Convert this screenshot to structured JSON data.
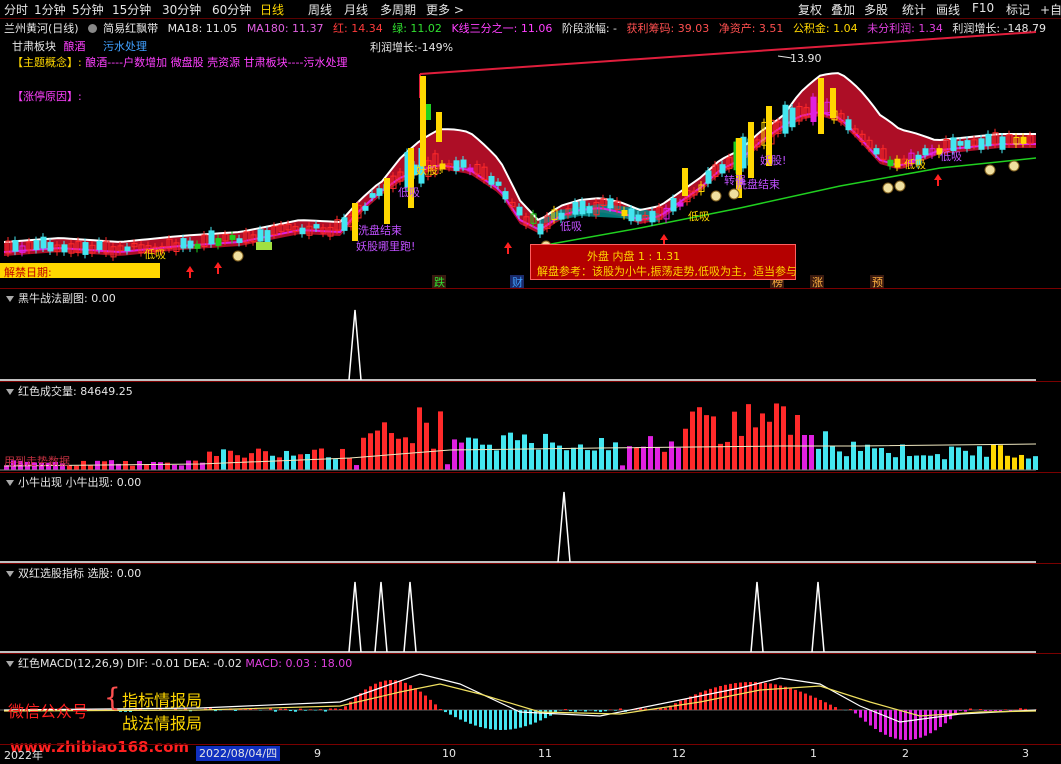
{
  "toolbar": {
    "items": [
      "分时",
      "1分钟",
      "5分钟",
      "15分钟",
      "30分钟",
      "60分钟",
      "日线",
      "周线",
      "月线",
      "多周期",
      "更多 >"
    ],
    "active": "日线",
    "right_items": [
      "复权",
      "叠加",
      "多股",
      "统计",
      "画线",
      "F10",
      "标记",
      "+自选"
    ]
  },
  "legend": {
    "stock": "兰州黄河(日线)",
    "indicator": "简易红飘带",
    "ma18": "MA18: 11.05",
    "ma180": "MA180: 11.37",
    "red": "红: 14.34",
    "green": "绿: 11.02",
    "kline_third": "K线三分之一: 11.06",
    "stage_gain": "阶段涨幅: -",
    "profit_chips": "获利筹码: 39.03",
    "net_asset": "净资产: 3.51",
    "fund": "公积金: 1.04",
    "undistributed": "未分利润: 1.34",
    "profit_growth": "利润增长: -148.79"
  },
  "info": {
    "sector_label": "甘肃板块",
    "tag1": "酿酒",
    "tag2": "污水处理",
    "profit_growth2": "利润增长:-149%",
    "concept_label": "【主题概念】:",
    "concept_text": "酿酒----户数增加 微盘股 壳资源 甘肃板块----污水处理",
    "limit_reason": "【涨停原因】:",
    "unlock_date": "解禁日期:"
  },
  "main_chart": {
    "high_label": "13.90",
    "annotations": [
      "妖股!",
      "低吸",
      "洗盘结束",
      "低吸",
      "妖股哪里跑!",
      "低吸",
      "低吸",
      "妖股!",
      "洗盘结束",
      "低吸",
      "低吸",
      "转强"
    ],
    "bottom_tags": [
      "跌",
      "财",
      "榜",
      "涨",
      "预"
    ],
    "popup_line1": "外盘  内盘   1  :  1.31",
    "popup_line2": "解盘参考：该股为小牛,振荡走势,低吸为主，适当参与"
  },
  "panels": {
    "p1": {
      "name": "黑牛战法副图",
      "value": ": 0.00"
    },
    "p2": {
      "name": "红色成交量",
      "value": ": 84649.25",
      "watermark": "用到走势数据"
    },
    "p3": {
      "name": "小牛出现",
      "value": "小牛出现: 0.00"
    },
    "p4": {
      "name": "双红选股指标",
      "value": "选股: 0.00"
    },
    "p5": {
      "name": "红色MACD(12,26,9)",
      "dif": "DIF: -0.01",
      "dea": "DEA: -0.02",
      "macd": "MACD: 0.03 : 18.00"
    }
  },
  "watermark": {
    "wechat": "微信公众号",
    "line1": "指标情报局",
    "line2": "战法情报局",
    "site": "www.zhibiao168.com"
  },
  "axis": {
    "labels": [
      "2022年",
      "9",
      "10",
      "11",
      "12",
      "1",
      "2",
      "3"
    ],
    "cursor_date": "2022/08/04/四"
  },
  "colors": {
    "up": "#ff2a2a",
    "down": "#44e6f0",
    "ribbon": "#c0102a",
    "ribbon_cyan": "#008c8c",
    "ma_white": "#ffffff",
    "ma_magenta": "#e020e0",
    "ma_green": "#20d020",
    "trend_red": "#e01e3c",
    "yellow": "#ffd700"
  }
}
